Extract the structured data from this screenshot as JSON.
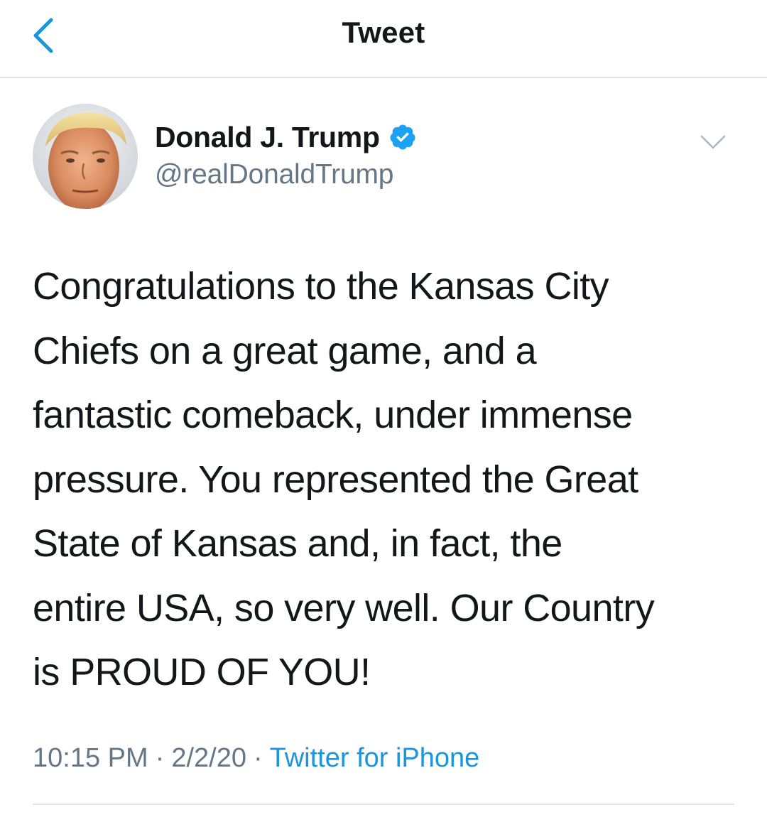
{
  "nav": {
    "title": "Tweet"
  },
  "author": {
    "name": "Donald J. Trump",
    "handle": "@realDonaldTrump",
    "verified": true
  },
  "tweet": {
    "lines": [
      "Congratulations to the Kansas City",
      "Chiefs on a great game, and a",
      "fantastic comeback, under immense",
      "pressure. You represented the Great",
      "State of Kansas and, in fact, the",
      "entire USA, so very well. Our Country",
      "is PROUD OF YOU!"
    ],
    "time": "10:15 PM",
    "date": "2/2/20",
    "separator": "·",
    "source": "Twitter for iPhone"
  },
  "icons": {
    "back": "chevron-left-icon",
    "verified": "verified-badge-icon",
    "more": "chevron-down-icon"
  },
  "colors": {
    "accent": "#1b95e0",
    "text": "#14171a",
    "secondary": "#657786",
    "divider": "#e1e8ed"
  }
}
